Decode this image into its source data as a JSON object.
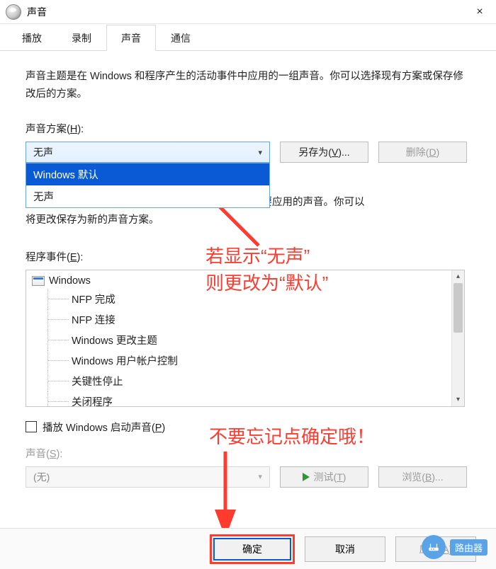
{
  "window": {
    "title": "声音",
    "close": "×"
  },
  "tabs": [
    "播放",
    "录制",
    "声音",
    "通信"
  ],
  "active_tab": 2,
  "description": "声音主题是在 Windows 和程序产生的活动事件中应用的一组声音。你可以选择现有方案或保存修改后的方案。",
  "scheme_label": {
    "pre": "声音方案(",
    "key": "H",
    "post": "):"
  },
  "scheme": {
    "selected": "无声",
    "options": [
      "Windows 默认",
      "无声"
    ]
  },
  "save_as": {
    "pre": "另存为(",
    "key": "V",
    "post": ")..."
  },
  "delete_btn": {
    "pre": "删除(",
    "key": "D",
    "post": ")"
  },
  "paragraph2_suffix": "，然后选择要应用的声音。你可以",
  "paragraph2_line2": "将更改保存为新的声音方案。",
  "events_label": {
    "pre": "程序事件(",
    "key": "E",
    "post": "):"
  },
  "events": {
    "root": "Windows",
    "items": [
      "NFP 完成",
      "NFP 连接",
      "Windows 更改主题",
      "Windows 用户帐户控制",
      "关键性停止",
      "关闭程序"
    ]
  },
  "play_startup": {
    "pre": "播放 Windows 启动声音(",
    "key": "P",
    "post": ")"
  },
  "sound_label": {
    "pre": "声音(",
    "key": "S",
    "post": "):"
  },
  "sound_value": "(无)",
  "test_btn": {
    "pre": "测试(",
    "key": "T",
    "post": ")"
  },
  "browse_btn": {
    "pre": "浏览(",
    "key": "B",
    "post": ")..."
  },
  "buttons": {
    "ok": "确定",
    "cancel": "取消"
  },
  "apply_btn": {
    "pre": "应用(",
    "key": "A",
    "post": ")"
  },
  "annot1_l1": "若显示“无声”",
  "annot1_l2": "则更改为“默认”",
  "annot2": "不要忘记点确定哦！",
  "watermark": "路由器"
}
